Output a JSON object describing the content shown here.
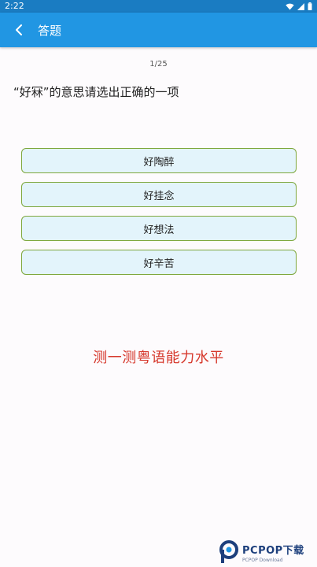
{
  "status_bar": {
    "time": "2:22"
  },
  "app_bar": {
    "title": "答题"
  },
  "quiz": {
    "progress": "1/25",
    "question": "“好冧”的意思请选出正确的一项",
    "options": [
      "好陶醉",
      "好挂念",
      "好想法",
      "好辛苦"
    ]
  },
  "banner": "测一测粤语能力水平",
  "watermark": {
    "brand": "PCPOP下载",
    "sub": "PCPOP Download"
  },
  "colors": {
    "status_bar": "#1a7cc2",
    "app_bar": "#2196e3",
    "option_fill": "#e3f4fb",
    "option_border": "#7ea73c",
    "banner_text": "#d6382c"
  },
  "icons": [
    "wifi-icon",
    "cellular-signal-icon",
    "battery-icon",
    "back-arrow-icon",
    "pcpop-logo-icon"
  ]
}
